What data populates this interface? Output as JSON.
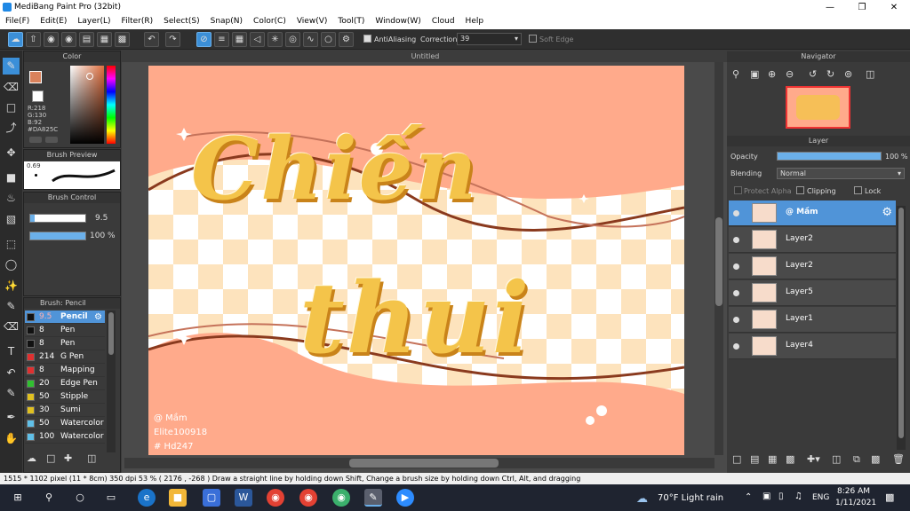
{
  "window": {
    "title": "MediBang Paint Pro (32bit)"
  },
  "menu": [
    "File(F)",
    "Edit(E)",
    "Layer(L)",
    "Filter(R)",
    "Select(S)",
    "Snap(N)",
    "Color(C)",
    "View(V)",
    "Tool(T)",
    "Window(W)",
    "Cloud",
    "Help"
  ],
  "toolbar": {
    "antialiasing": "AntiAliasing",
    "correction_label": "Correction",
    "correction_value": "39",
    "soft_edge": "Soft Edge"
  },
  "color_panel": {
    "title": "Color",
    "r": "R:218",
    "g": "G:130",
    "b": "B:92",
    "hex": "#DA825C",
    "primary": "#DA825C"
  },
  "brush_preview": {
    "title": "Brush Preview",
    "size": "0.69"
  },
  "brush_control": {
    "title": "Brush Control",
    "size": "9.5",
    "opacity": "100 %",
    "size_fill": 0.08,
    "opacity_fill": 1.0
  },
  "brush_list": {
    "title": "Brush: Pencil",
    "items": [
      {
        "size": "9.5",
        "name": "Pencil",
        "color": "#111111"
      },
      {
        "size": "8",
        "name": "Pen",
        "color": "#111111"
      },
      {
        "size": "8",
        "name": "Pen (Sharp)",
        "color": "#111111"
      },
      {
        "size": "214",
        "name": "G Pen",
        "color": "#e03030"
      },
      {
        "size": "8",
        "name": "Mapping Pen",
        "color": "#e03030"
      },
      {
        "size": "20",
        "name": "Edge Pen",
        "color": "#30c030"
      },
      {
        "size": "50",
        "name": "Stipple Pen",
        "color": "#e0c020"
      },
      {
        "size": "30",
        "name": "Sumi",
        "color": "#e0c020"
      },
      {
        "size": "50",
        "name": "Watercolor",
        "color": "#60c0e8"
      },
      {
        "size": "100",
        "name": "Watercolor",
        "color": "#60c0e8"
      }
    ]
  },
  "document": {
    "tab": "Untitled"
  },
  "artwork": {
    "title_line1": "Chiến",
    "title_line2": "thui",
    "credit1": "@ Mầm",
    "credit2": "Elite100918",
    "credit3": "# Hd247"
  },
  "navigator": {
    "title": "Navigator"
  },
  "layer_panel": {
    "title": "Layer",
    "opacity_label": "Opacity",
    "opacity_value": "100 %",
    "blending_label": "Blending",
    "blending_value": "Normal",
    "protect_alpha": "Protect Alpha",
    "clipping": "Clipping",
    "lock": "Lock",
    "layers": [
      {
        "name": "@ Mầm"
      },
      {
        "name": "Layer2"
      },
      {
        "name": "Layer2"
      },
      {
        "name": "Layer5"
      },
      {
        "name": "Layer1"
      },
      {
        "name": "Layer4"
      }
    ]
  },
  "status": {
    "text": "1515 * 1102 pixel  (11 * 8cm)  350 dpi  53 %  ( 2176 , -268 )  Draw a straight line by holding down Shift, Change a brush size by holding down Ctrl, Alt, and dragging"
  },
  "taskbar": {
    "weather": "70°F  Light rain",
    "lang": "ENG",
    "time": "8:26 AM",
    "date": "1/11/2021"
  }
}
